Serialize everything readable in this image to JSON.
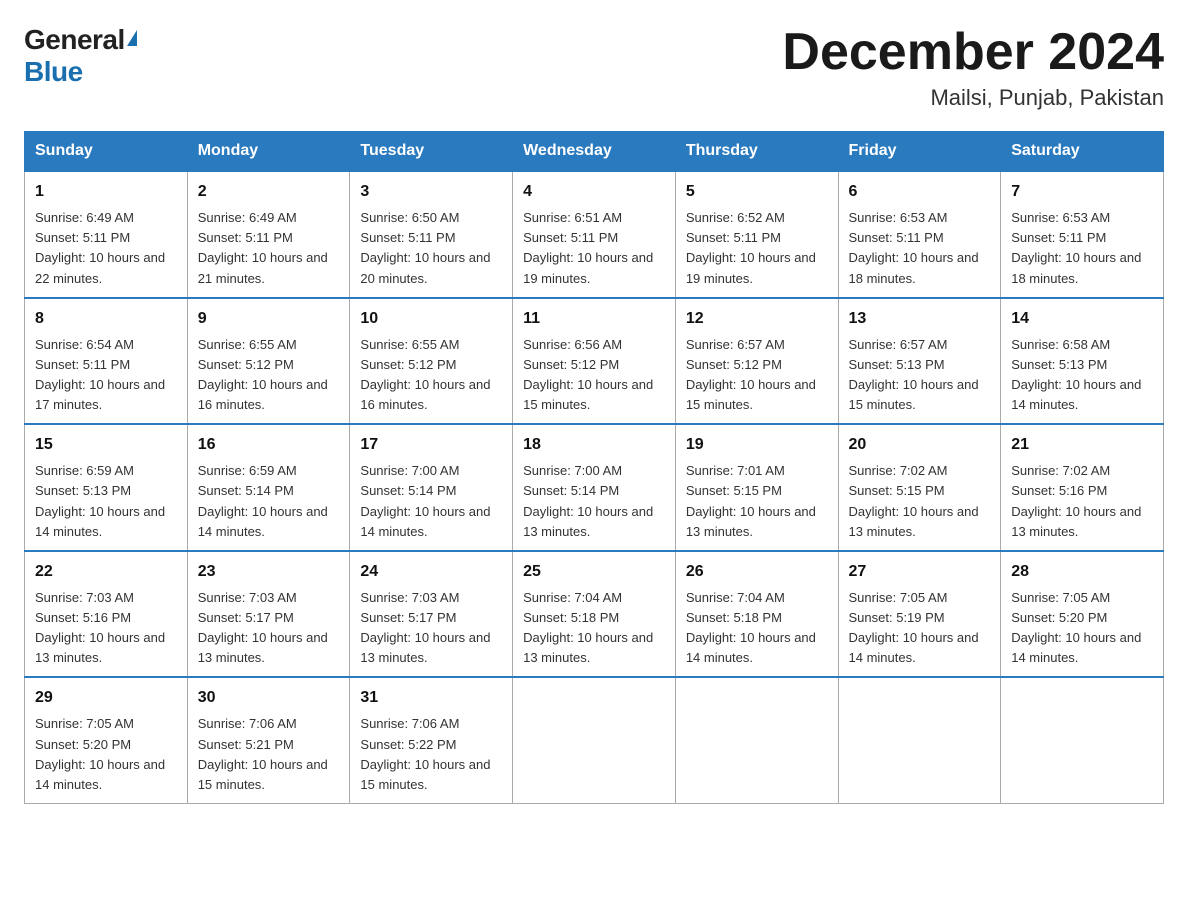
{
  "logo": {
    "general": "General",
    "blue": "Blue"
  },
  "title": {
    "month_year": "December 2024",
    "location": "Mailsi, Punjab, Pakistan"
  },
  "headers": [
    "Sunday",
    "Monday",
    "Tuesday",
    "Wednesday",
    "Thursday",
    "Friday",
    "Saturday"
  ],
  "weeks": [
    [
      {
        "day": "1",
        "sunrise": "6:49 AM",
        "sunset": "5:11 PM",
        "daylight": "10 hours and 22 minutes."
      },
      {
        "day": "2",
        "sunrise": "6:49 AM",
        "sunset": "5:11 PM",
        "daylight": "10 hours and 21 minutes."
      },
      {
        "day": "3",
        "sunrise": "6:50 AM",
        "sunset": "5:11 PM",
        "daylight": "10 hours and 20 minutes."
      },
      {
        "day": "4",
        "sunrise": "6:51 AM",
        "sunset": "5:11 PM",
        "daylight": "10 hours and 19 minutes."
      },
      {
        "day": "5",
        "sunrise": "6:52 AM",
        "sunset": "5:11 PM",
        "daylight": "10 hours and 19 minutes."
      },
      {
        "day": "6",
        "sunrise": "6:53 AM",
        "sunset": "5:11 PM",
        "daylight": "10 hours and 18 minutes."
      },
      {
        "day": "7",
        "sunrise": "6:53 AM",
        "sunset": "5:11 PM",
        "daylight": "10 hours and 18 minutes."
      }
    ],
    [
      {
        "day": "8",
        "sunrise": "6:54 AM",
        "sunset": "5:11 PM",
        "daylight": "10 hours and 17 minutes."
      },
      {
        "day": "9",
        "sunrise": "6:55 AM",
        "sunset": "5:12 PM",
        "daylight": "10 hours and 16 minutes."
      },
      {
        "day": "10",
        "sunrise": "6:55 AM",
        "sunset": "5:12 PM",
        "daylight": "10 hours and 16 minutes."
      },
      {
        "day": "11",
        "sunrise": "6:56 AM",
        "sunset": "5:12 PM",
        "daylight": "10 hours and 15 minutes."
      },
      {
        "day": "12",
        "sunrise": "6:57 AM",
        "sunset": "5:12 PM",
        "daylight": "10 hours and 15 minutes."
      },
      {
        "day": "13",
        "sunrise": "6:57 AM",
        "sunset": "5:13 PM",
        "daylight": "10 hours and 15 minutes."
      },
      {
        "day": "14",
        "sunrise": "6:58 AM",
        "sunset": "5:13 PM",
        "daylight": "10 hours and 14 minutes."
      }
    ],
    [
      {
        "day": "15",
        "sunrise": "6:59 AM",
        "sunset": "5:13 PM",
        "daylight": "10 hours and 14 minutes."
      },
      {
        "day": "16",
        "sunrise": "6:59 AM",
        "sunset": "5:14 PM",
        "daylight": "10 hours and 14 minutes."
      },
      {
        "day": "17",
        "sunrise": "7:00 AM",
        "sunset": "5:14 PM",
        "daylight": "10 hours and 14 minutes."
      },
      {
        "day": "18",
        "sunrise": "7:00 AM",
        "sunset": "5:14 PM",
        "daylight": "10 hours and 13 minutes."
      },
      {
        "day": "19",
        "sunrise": "7:01 AM",
        "sunset": "5:15 PM",
        "daylight": "10 hours and 13 minutes."
      },
      {
        "day": "20",
        "sunrise": "7:02 AM",
        "sunset": "5:15 PM",
        "daylight": "10 hours and 13 minutes."
      },
      {
        "day": "21",
        "sunrise": "7:02 AM",
        "sunset": "5:16 PM",
        "daylight": "10 hours and 13 minutes."
      }
    ],
    [
      {
        "day": "22",
        "sunrise": "7:03 AM",
        "sunset": "5:16 PM",
        "daylight": "10 hours and 13 minutes."
      },
      {
        "day": "23",
        "sunrise": "7:03 AM",
        "sunset": "5:17 PM",
        "daylight": "10 hours and 13 minutes."
      },
      {
        "day": "24",
        "sunrise": "7:03 AM",
        "sunset": "5:17 PM",
        "daylight": "10 hours and 13 minutes."
      },
      {
        "day": "25",
        "sunrise": "7:04 AM",
        "sunset": "5:18 PM",
        "daylight": "10 hours and 13 minutes."
      },
      {
        "day": "26",
        "sunrise": "7:04 AM",
        "sunset": "5:18 PM",
        "daylight": "10 hours and 14 minutes."
      },
      {
        "day": "27",
        "sunrise": "7:05 AM",
        "sunset": "5:19 PM",
        "daylight": "10 hours and 14 minutes."
      },
      {
        "day": "28",
        "sunrise": "7:05 AM",
        "sunset": "5:20 PM",
        "daylight": "10 hours and 14 minutes."
      }
    ],
    [
      {
        "day": "29",
        "sunrise": "7:05 AM",
        "sunset": "5:20 PM",
        "daylight": "10 hours and 14 minutes."
      },
      {
        "day": "30",
        "sunrise": "7:06 AM",
        "sunset": "5:21 PM",
        "daylight": "10 hours and 15 minutes."
      },
      {
        "day": "31",
        "sunrise": "7:06 AM",
        "sunset": "5:22 PM",
        "daylight": "10 hours and 15 minutes."
      },
      null,
      null,
      null,
      null
    ]
  ],
  "labels": {
    "sunrise": "Sunrise:",
    "sunset": "Sunset:",
    "daylight": "Daylight:"
  }
}
